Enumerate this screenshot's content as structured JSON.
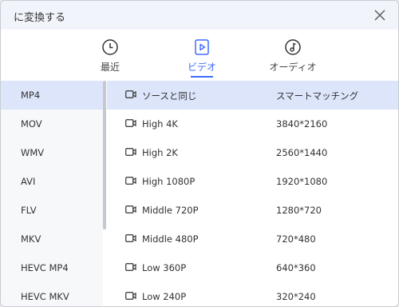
{
  "dialog": {
    "title": "に変換する",
    "close_icon": "close-icon"
  },
  "tabs": [
    {
      "label": "最近",
      "icon": "clock-icon",
      "active": false
    },
    {
      "label": "ビデオ",
      "icon": "video-icon",
      "active": true
    },
    {
      "label": "オーディオ",
      "icon": "music-note-icon",
      "active": false
    }
  ],
  "accent_color": "#3f6bff",
  "selected_bg": "#dde5fb",
  "formats": [
    {
      "label": "MP4",
      "selected": true
    },
    {
      "label": "MOV"
    },
    {
      "label": "WMV"
    },
    {
      "label": "AVI"
    },
    {
      "label": "FLV"
    },
    {
      "label": "MKV"
    },
    {
      "label": "HEVC MP4"
    },
    {
      "label": "HEVC MKV"
    }
  ],
  "presets": [
    {
      "name": "ソースと同じ",
      "resolution": "スマートマッチング",
      "icon": "video-camera-icon",
      "selected": true
    },
    {
      "name": "High 4K",
      "resolution": "3840*2160",
      "icon": "video-camera-icon"
    },
    {
      "name": "High 2K",
      "resolution": "2560*1440",
      "icon": "video-camera-icon"
    },
    {
      "name": "High 1080P",
      "resolution": "1920*1080",
      "icon": "video-camera-icon"
    },
    {
      "name": "Middle 720P",
      "resolution": "1280*720",
      "icon": "video-camera-icon"
    },
    {
      "name": "Middle 480P",
      "resolution": "720*480",
      "icon": "video-camera-icon"
    },
    {
      "name": "Low 360P",
      "resolution": "640*360",
      "icon": "video-camera-icon"
    },
    {
      "name": "Low 240P",
      "resolution": "320*240",
      "icon": "video-camera-icon"
    }
  ]
}
